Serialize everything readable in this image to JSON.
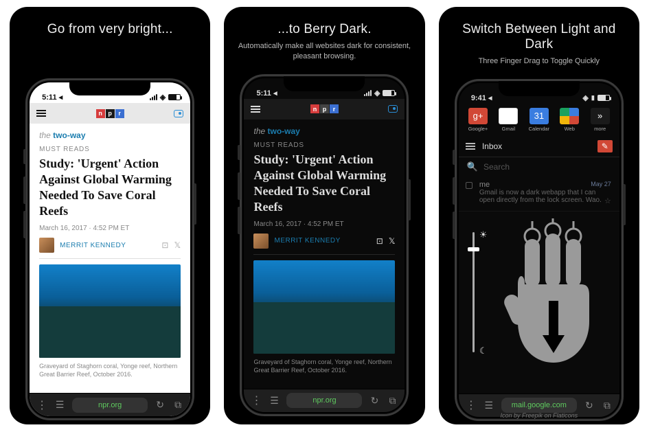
{
  "cards": [
    {
      "heading": "Go from very bright..."
    },
    {
      "heading": "...to Berry Dark.",
      "sub": "Automatically make all websites dark for consistent, pleasant browsing."
    },
    {
      "heading": "Switch Between Light and Dark",
      "sub": "Three Finger Drag to Toggle Quickly",
      "credit": "Icon by Freepik on Flaticons"
    }
  ],
  "statusbar": {
    "time1": "5:11",
    "time3": "9:41"
  },
  "article": {
    "section_pre": "the ",
    "section": "two-way",
    "kicker": "MUST READS",
    "headline": "Study: 'Urgent' Action Against Global Warming Needed To Save Coral Reefs",
    "dateline": "March 16, 2017 · 4:52 PM ET",
    "byline": "MERRIT KENNEDY",
    "caption": "Graveyard of Staghorn coral, Yonge reef, Northern Great Barrier Reef, October 2016."
  },
  "browser": {
    "url1": "npr.org",
    "url3": "mail.google.com"
  },
  "gapps": {
    "gplus": "Google+",
    "gmail": "Gmail",
    "cal": "Calendar",
    "web": "Web",
    "more": "more"
  },
  "inbox": {
    "title": "Inbox",
    "search": "Search",
    "from": "me",
    "date": "May 27",
    "line1": "Gmail is now a dark webapp that I can",
    "line2": "open directly from the lock screen. Wao."
  },
  "npr": {
    "n": "n",
    "p": "p",
    "r": "r"
  }
}
